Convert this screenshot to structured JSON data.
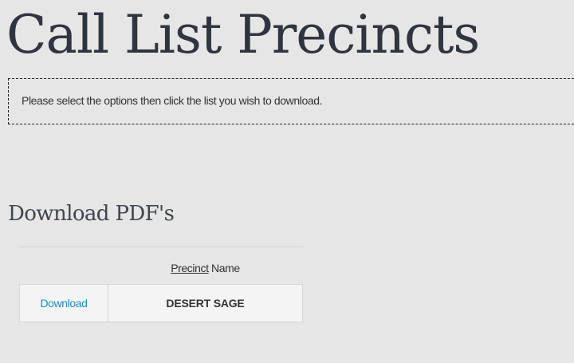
{
  "page": {
    "title": "Call List Precincts"
  },
  "notice": {
    "text": "Please select the options then click the list you wish to download."
  },
  "download_section": {
    "heading": "Download PDF's",
    "table": {
      "header_link": "Precinct",
      "header_suffix": " Name",
      "rows": [
        {
          "action": "Download",
          "name": "DESERT SAGE"
        }
      ]
    }
  },
  "colors": {
    "background": "#e6e6e6",
    "title": "#2f3540",
    "link": "#1a8fc7",
    "row_background": "#f4f4f4"
  }
}
